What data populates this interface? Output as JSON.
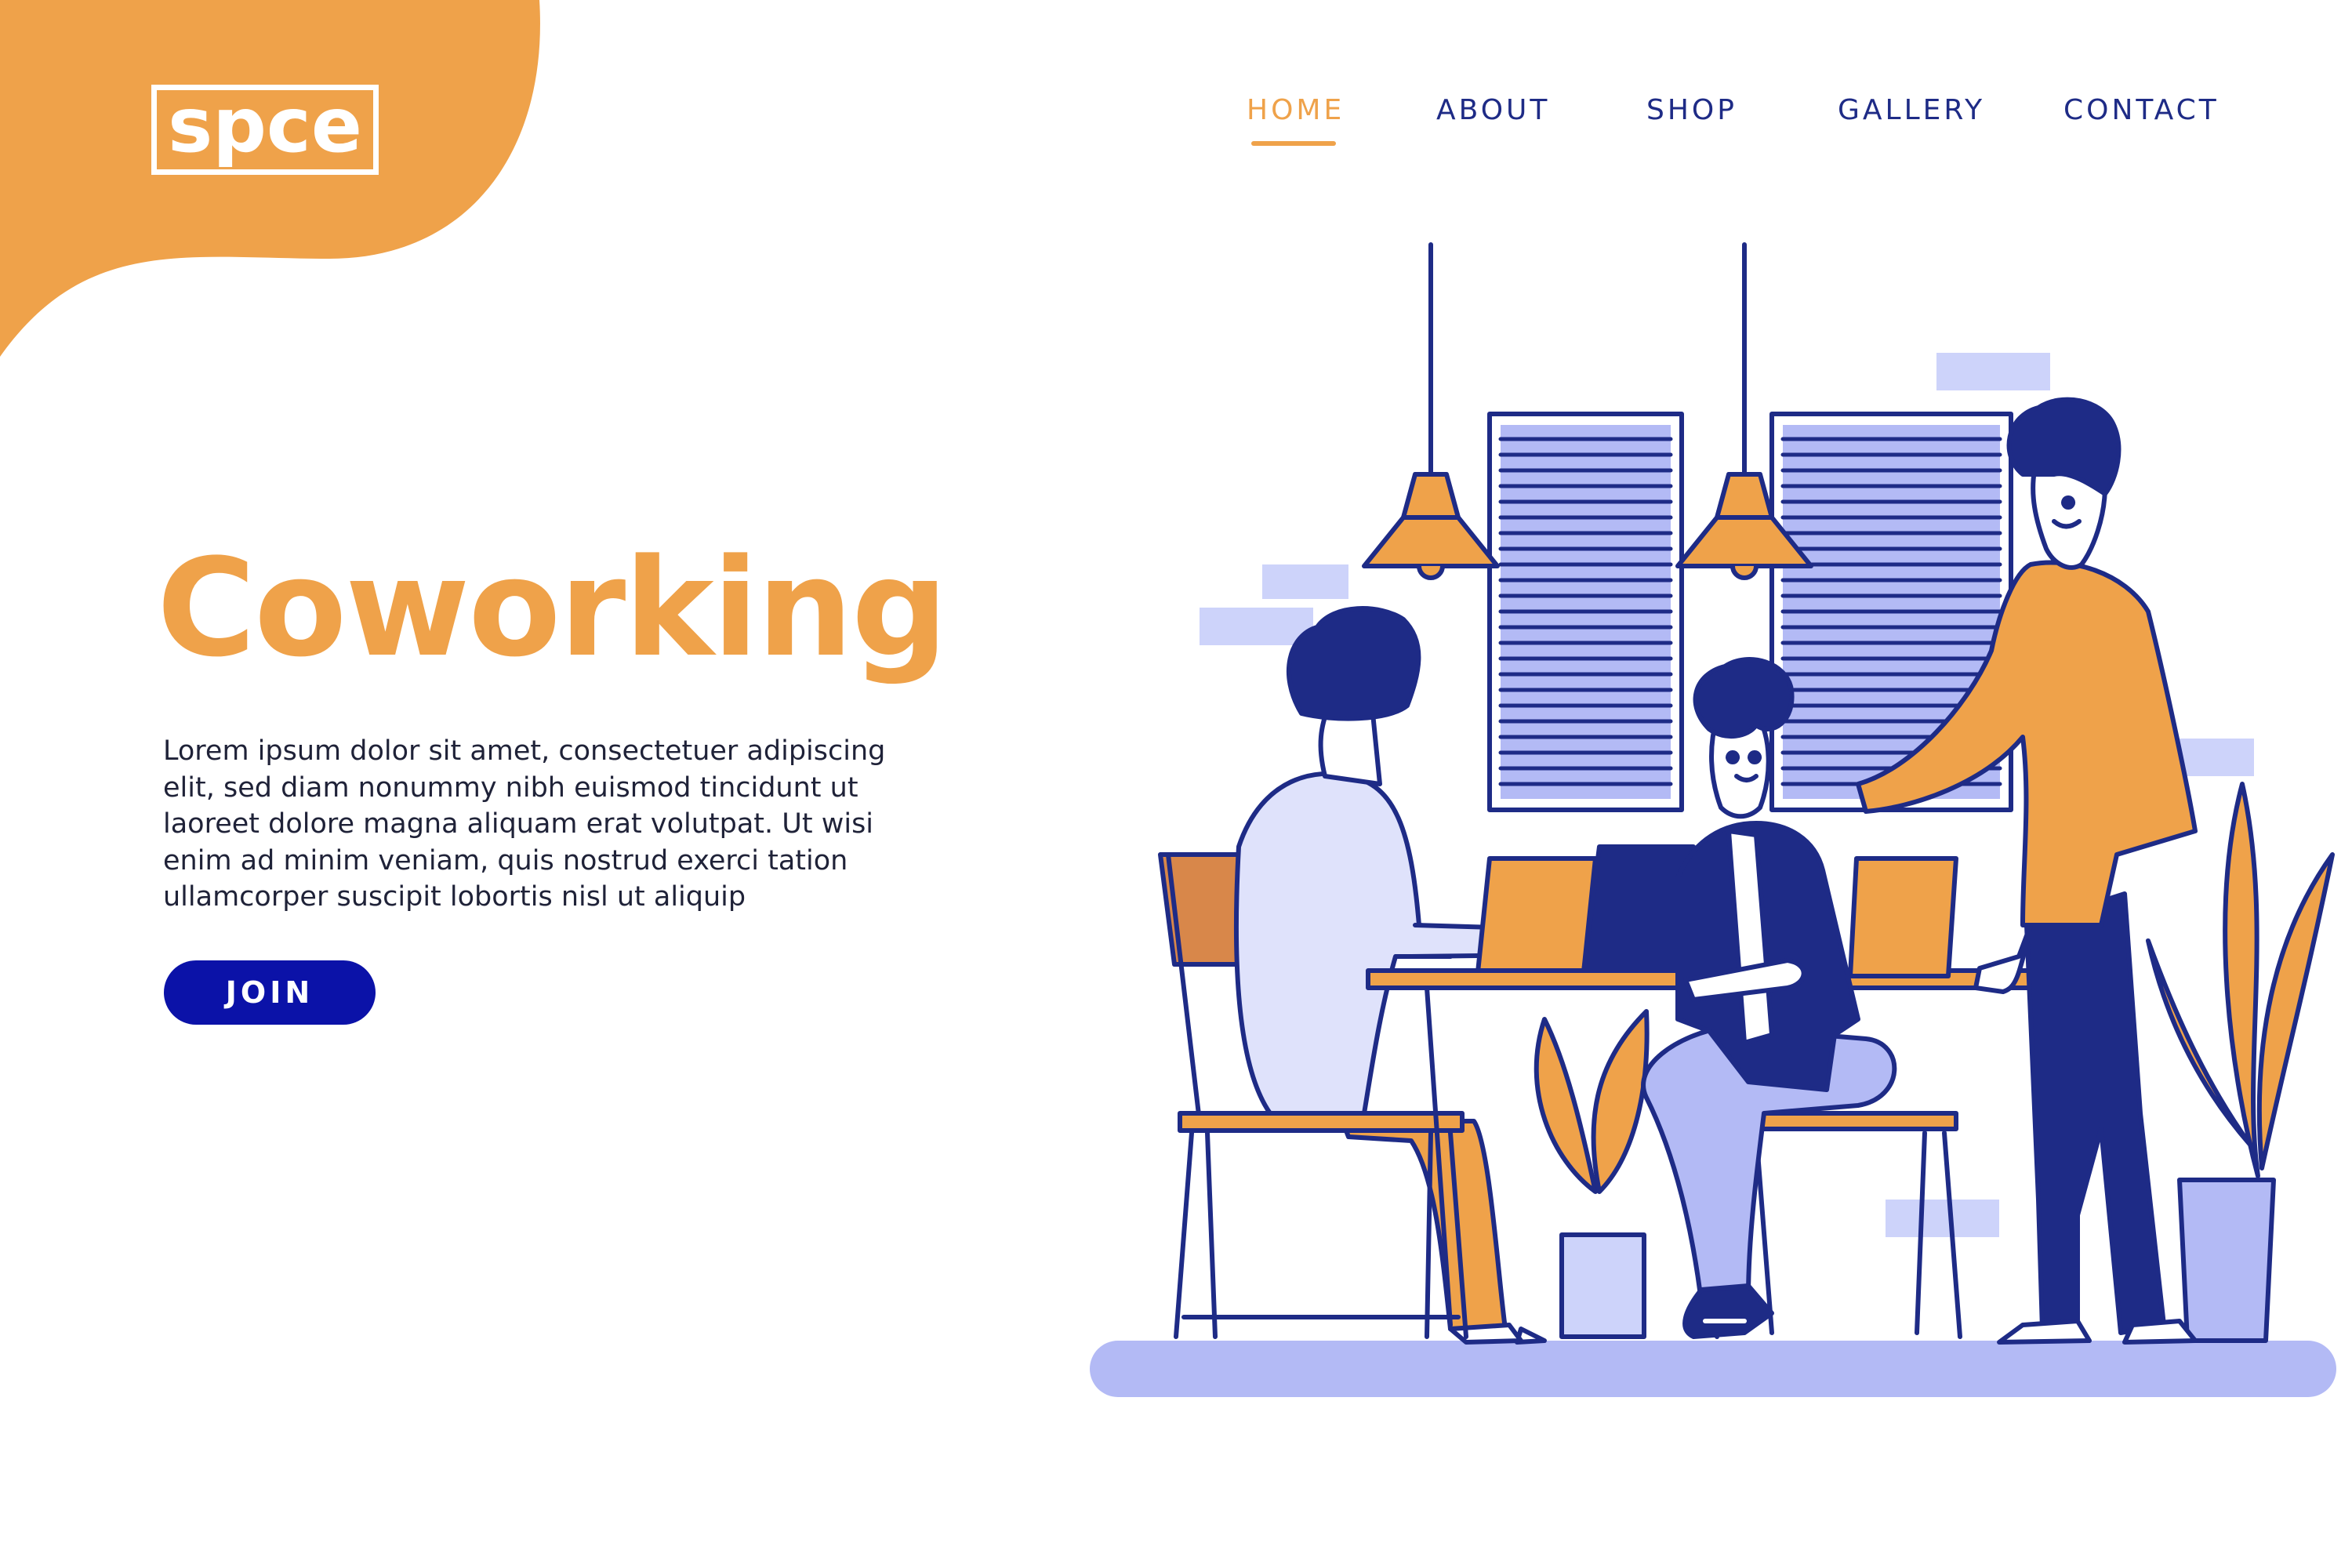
{
  "brand": {
    "logo_text": "spce",
    "accent_color": "#efa24a",
    "navy_color": "#1e2b86",
    "button_color": "#0b12a8",
    "pale_blue_color": "#b3baf5"
  },
  "nav": {
    "items": [
      {
        "label": "HOME",
        "active": true
      },
      {
        "label": "ABOUT",
        "active": false
      },
      {
        "label": "SHOP",
        "active": false
      },
      {
        "label": "GALLERY",
        "active": false
      },
      {
        "label": "CONTACT",
        "active": false
      }
    ]
  },
  "hero": {
    "title": "Coworking",
    "body_lines": [
      "Lorem ipsum dolor sit amet, consectetuer adipiscing",
      "elit, sed diam nonummy nibh euismod tincidunt ut",
      "laoreet dolore magna aliquam erat volutpat. Ut wisi",
      "enim ad minim veniam, quis nostrud exerci tation",
      "ullamcorper suscipit lobortis nisl ut aliquip"
    ],
    "cta_label": "JOIN"
  },
  "illustration": {
    "subject": "three people working together at a shared desk with laptops",
    "icons": [
      "pendant-lamp-icon",
      "window-blinds-icon",
      "potted-plant-icon",
      "laptop-icon",
      "chair-icon"
    ]
  }
}
